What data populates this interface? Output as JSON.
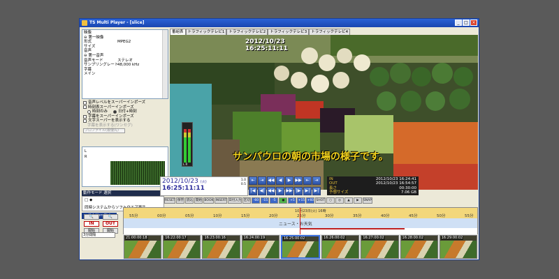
{
  "window": {
    "title": "TS Multi Player - [slice]",
    "buttons": [
      "_",
      "□",
      "×"
    ]
  },
  "info_panel": {
    "rows": [
      {
        "k": "映像",
        "v": ""
      },
      {
        "k": "⊖ 第一映像",
        "v": ""
      },
      {
        "k": "形式",
        "v": "MPEG2"
      },
      {
        "k": "サイズ",
        "v": ""
      },
      {
        "k": "音声",
        "v": ""
      },
      {
        "k": "⊖ 第一音声",
        "v": ""
      },
      {
        "k": "音声モード",
        "v": "ステレオ"
      },
      {
        "k": "サンプリングレート",
        "v": "48,000 kHz"
      },
      {
        "k": "字幕",
        "v": ""
      },
      {
        "k": "メイン",
        "v": ""
      }
    ]
  },
  "options": {
    "audio_super": "音声レベルをスーパーインポーズ",
    "time_super": "時刻表スーパーインポーズ",
    "time_only": "時刻のみ",
    "date_time": "日付+時刻",
    "caption_super": "字幕をスーパーインポーズ",
    "text_super": "文字スーパーを表示する",
    "caption_display": "字幕を表示する(ワンセグ)",
    "profile": "プロファイル(最優先)"
  },
  "meter": {
    "l": "L",
    "r": "R"
  },
  "tabs": [
    "番組表",
    "トラフィックテレビ1",
    "トラフィックテレビ2",
    "トラフィックテレビ3",
    "トラフィックテレビ4"
  ],
  "video": {
    "timestamp_date": "2012/10/23",
    "timestamp_time": "16:25:11:11",
    "subtitle": "サンパウロの朝の市場の様子です。",
    "meter_label": "L R"
  },
  "mode": {
    "title": "動作モード 選択",
    "line1": "□ ◆",
    "line2": "同時システムからソフトウエア再生"
  },
  "timecode": {
    "date": "2012/10/23",
    "weekday": "(火)",
    "time": "16:25:11:11",
    "r1": "1.0",
    "r2": "0.5"
  },
  "nav_buttons": [
    "⇤",
    "⇥",
    "◀◀",
    "◀",
    "▶",
    "▶▶",
    "⇤",
    "⇥",
    "|◀",
    "◀|",
    "◀◀",
    "▶",
    "▶▶",
    "|▶",
    "▶|",
    "▶|"
  ],
  "in_out": {
    "rows": [
      {
        "k": "IN",
        "v": "2012/10/23 16:24:41"
      },
      {
        "k": "OUT",
        "v": "2012/10/23 16:54:57"
      },
      {
        "k": "長さ",
        "v": "00:30:00"
      },
      {
        "k": "予想サイズ",
        "v": "7.06 GB"
      }
    ]
  },
  "toolbar": [
    "RESET",
    "保存",
    "読込",
    "開始",
    "BOOK",
    "INSERT",
    "日付入力",
    "区切",
    "-60",
    "-15",
    "-5",
    "●",
    "+5",
    "+15",
    "+60",
    "SHOT",
    "○",
    "◎",
    "▲",
    "▶",
    "SNAP"
  ],
  "logo": "YoJoHan Ctrl",
  "left_tools": {
    "in": "IN",
    "out": "OUT",
    "a": "開始",
    "b": "開始",
    "select": "3分間隔"
  },
  "timeline": {
    "date": "10月23日(火) 16時",
    "ticks": [
      "55分",
      "00分",
      "05分",
      "10分",
      "15分",
      "20分",
      "25分",
      "30分",
      "35分",
      "40分",
      "45分",
      "50分",
      "55分"
    ],
    "program": "ニュース・お天気"
  },
  "thumbnails": [
    "21:00:00:18",
    "16:22:00:17",
    "16:23:00:16",
    "16:24:00:19",
    "16:25:00:02",
    "16:26:00:02",
    "16:27:00:02",
    "16:28:00:02",
    "16:29:00:02"
  ]
}
